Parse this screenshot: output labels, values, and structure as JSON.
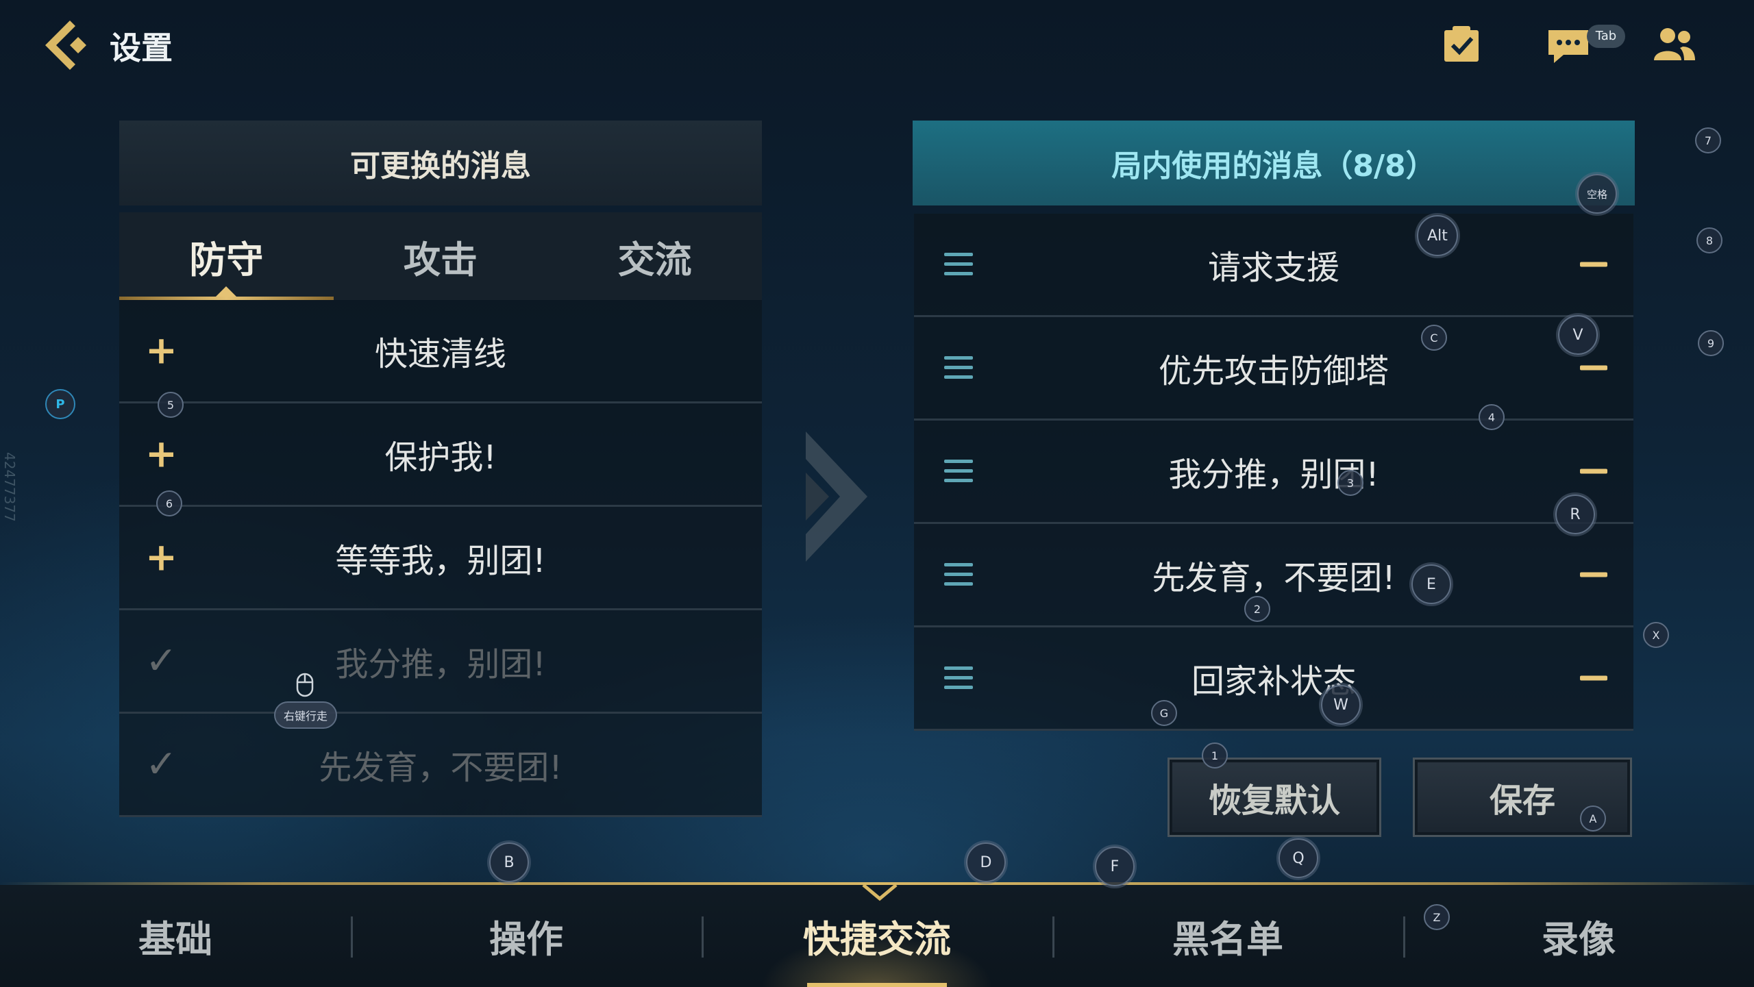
{
  "header": {
    "title": "设置",
    "tab_key": "Tab"
  },
  "left_panel": {
    "title": "可更换的消息",
    "tabs": [
      {
        "label": "防守",
        "active": true
      },
      {
        "label": "攻击",
        "active": false
      },
      {
        "label": "交流",
        "active": false
      }
    ],
    "items": [
      {
        "text": "快速清线",
        "state": "available",
        "icon": "plus-icon"
      },
      {
        "text": "保护我!",
        "state": "available",
        "icon": "plus-icon"
      },
      {
        "text": "等等我，别团!",
        "state": "available",
        "icon": "plus-icon"
      },
      {
        "text": "我分推，别团!",
        "state": "added",
        "icon": "check-icon"
      },
      {
        "text": "先发育，不要团!",
        "state": "added",
        "icon": "check-icon"
      }
    ]
  },
  "right_panel": {
    "title": "局内使用的消息（8/8）",
    "items": [
      {
        "text": "请求支援"
      },
      {
        "text": "优先攻击防御塔"
      },
      {
        "text": "我分推，别团!"
      },
      {
        "text": "先发育，不要团!"
      },
      {
        "text": "回家补状态"
      }
    ]
  },
  "buttons": {
    "reset": "恢复默认",
    "save": "保存"
  },
  "nav": {
    "items": [
      {
        "label": "基础",
        "active": false
      },
      {
        "label": "操作",
        "active": false
      },
      {
        "label": "快捷交流",
        "active": true
      },
      {
        "label": "黑名单",
        "active": false
      },
      {
        "label": "录像",
        "active": false
      }
    ]
  },
  "key_hints": {
    "p": "P",
    "n5": "5",
    "n6": "6",
    "mouse": "右键行走",
    "alt": "Alt",
    "space": "空格",
    "c": "C",
    "v": "V",
    "n4": "4",
    "n3": "3",
    "r": "R",
    "e": "E",
    "n2": "2",
    "g": "G",
    "w": "W",
    "n1": "1",
    "a": "A",
    "q": "Q",
    "b": "B",
    "d": "D",
    "f": "F",
    "z": "Z",
    "x": "X",
    "n7": "7",
    "n8": "8",
    "n9": "9"
  },
  "watermark": "42477377",
  "colors": {
    "gold": "#e8c77a",
    "teal_header": "#1d6f82",
    "teal_text": "#9fe7f2",
    "dark_row": "#0c161e"
  }
}
